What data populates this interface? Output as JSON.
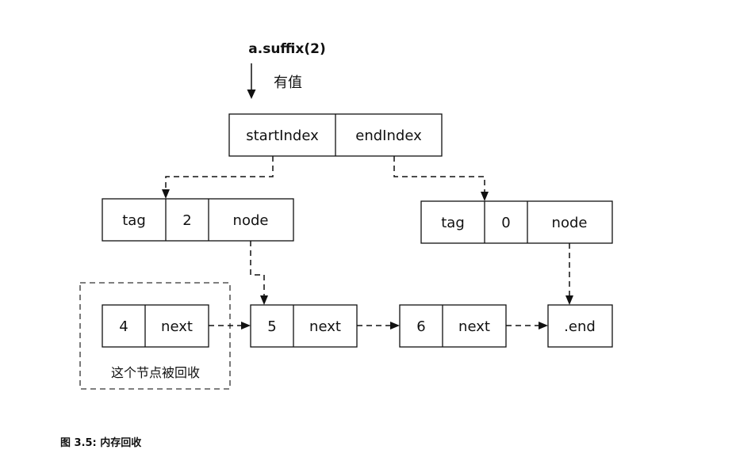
{
  "call": {
    "label": "a.suffix(2)",
    "arrow_note": "有值"
  },
  "range": {
    "cells": [
      "startIndex",
      "endIndex"
    ]
  },
  "left_tag": {
    "cells": [
      "tag",
      "2",
      "node"
    ]
  },
  "right_tag": {
    "cells": [
      "tag",
      "0",
      "node"
    ]
  },
  "nodes": [
    {
      "value": "4",
      "next": "next"
    },
    {
      "value": "5",
      "next": "next"
    },
    {
      "value": "6",
      "next": "next"
    }
  ],
  "end_node": {
    "label": ".end"
  },
  "gc_note": "这个节点被回收",
  "caption": "图 3.5: 内存回收"
}
